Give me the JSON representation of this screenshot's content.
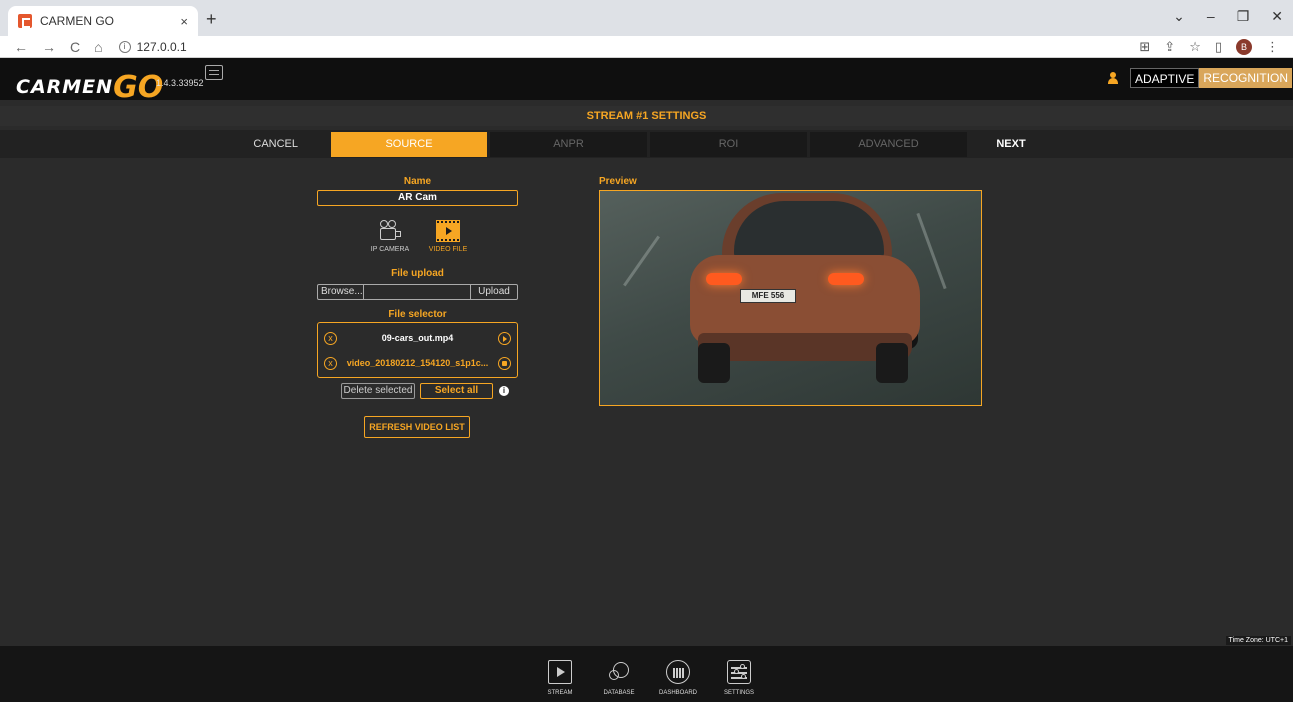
{
  "browser": {
    "tab_title": "CARMEN GO",
    "tab_close": "×",
    "new_tab": "+",
    "url": "127.0.0.1",
    "win_controls": [
      "⌄",
      "–",
      "❐",
      "✕"
    ],
    "nav": [
      "←",
      "→",
      "C",
      "⌂"
    ],
    "right_icons": [
      "⊞",
      "⇪",
      "☆",
      "▯"
    ],
    "profile_initial": "B",
    "menu": "⋮"
  },
  "app": {
    "logo_text": "CARMEN",
    "logo_go": "GO",
    "version": "1.4.3.33952",
    "brand_a": "ADAPTIVE",
    "brand_b": "RECOGNITION"
  },
  "page_title": "STREAM #1 SETTINGS",
  "wizard": {
    "cancel": "CANCEL",
    "tabs": [
      "SOURCE",
      "ANPR",
      "ROI",
      "ADVANCED"
    ],
    "next": "NEXT",
    "active": "SOURCE"
  },
  "form": {
    "name_label": "Name",
    "name_value": "AR Cam",
    "source_ip": "IP CAMERA",
    "source_video": "VIDEO FILE",
    "upload_label": "File upload",
    "browse": "Browse...",
    "upload": "Upload",
    "selector_label": "File selector",
    "files": [
      {
        "name": "09-cars_out.mp4",
        "action": "play"
      },
      {
        "name": "video_20180212_154120_s1p1c...",
        "action": "stop"
      }
    ],
    "remove_glyph": "x",
    "delete_selected": "Delete selected",
    "select_all": "Select all",
    "info_glyph": "i",
    "refresh": "REFRESH VIDEO LIST"
  },
  "preview": {
    "label": "Preview",
    "plate": "MFE 556"
  },
  "timezone": "Time Zone: UTC+1",
  "bottom_nav": [
    "STREAM",
    "DATABASE",
    "DASHBOARD",
    "SETTINGS"
  ],
  "colors": {
    "accent": "#f6a623",
    "bg": "#2b2b2b",
    "header": "#0f0f0f"
  }
}
